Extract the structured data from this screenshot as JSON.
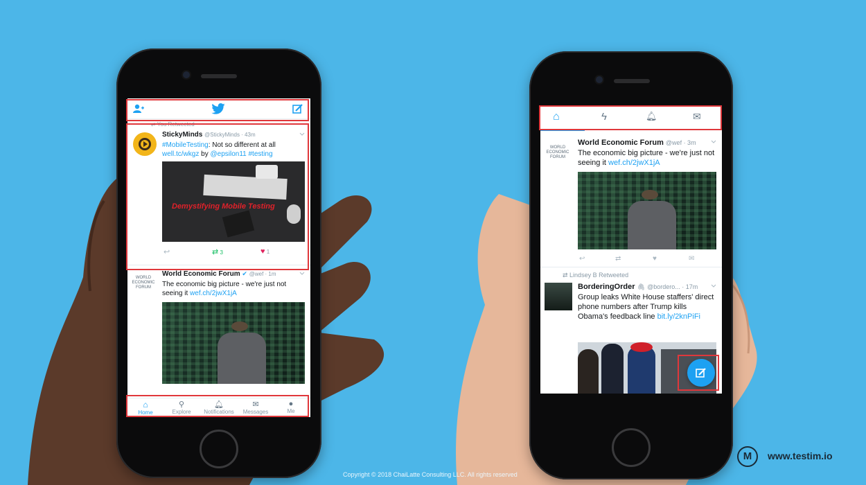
{
  "colors": {
    "background": "#4cb6e8",
    "twitter_blue": "#1da1f2",
    "highlight_red": "#e0373b",
    "retweet_green": "#17bf63",
    "like_red": "#e0245e"
  },
  "left_phone": {
    "topbar": {
      "add_user_icon": "add-user-icon",
      "logo_icon": "twitter-bird-icon",
      "compose_icon": "compose-icon"
    },
    "tweet1": {
      "retweet_context": "You Retweeted",
      "name": "StickyMinds",
      "handle": "@StickyMinds · 43m",
      "text_hashtag": "#MobileTesting",
      "text_rest": ": Not so different at all",
      "link": "well.tc/wkgz",
      "by": "by",
      "mention": "@epsilon11",
      "hashtag2": "#testing",
      "image_caption": "Demystifying Mobile Testing",
      "retweet_count": "3",
      "like_count": "1"
    },
    "tweet2": {
      "avatar_text": "WORLD ECONOMIC FORUM",
      "name": "World Economic Forum",
      "handle": "@wef · 1m",
      "text": "The economic big picture - we're just not seeing it",
      "link": "wef.ch/2jwX1jA"
    },
    "tabbar": [
      {
        "label": "Home",
        "icon": "home-icon"
      },
      {
        "label": "Explore",
        "icon": "search-icon"
      },
      {
        "label": "Notifications",
        "icon": "bell-icon"
      },
      {
        "label": "Messages",
        "icon": "envelope-icon"
      },
      {
        "label": "Me",
        "icon": "person-icon"
      }
    ]
  },
  "right_phone": {
    "topbar": [
      {
        "icon": "home-icon"
      },
      {
        "icon": "lightning-icon"
      },
      {
        "icon": "bell-icon"
      },
      {
        "icon": "envelope-icon"
      }
    ],
    "tweet1": {
      "avatar_text": "WORLD ECONOMIC FORUM",
      "name": "World Economic Forum",
      "handle": "@wef · 3m",
      "text": "The economic big picture - we're just not seeing it",
      "link": "wef.ch/2jwX1jA"
    },
    "tweet2": {
      "retweet_context": "Lindsey B Retweeted",
      "name": "BorderingOrder",
      "handle": "@bordero... · 17m",
      "text": "Group leaks White House staffers' direct phone numbers after Trump kills Obama's feedback line",
      "link": "bit.ly/2knPiFi"
    },
    "fab_icon": "compose-icon"
  },
  "footer": {
    "copyright": "Copyright © 2018 ChaiLatte Consulting LLC. All rights reserved"
  },
  "brand": {
    "logo_letter": "M",
    "url": "www.testim.io"
  }
}
